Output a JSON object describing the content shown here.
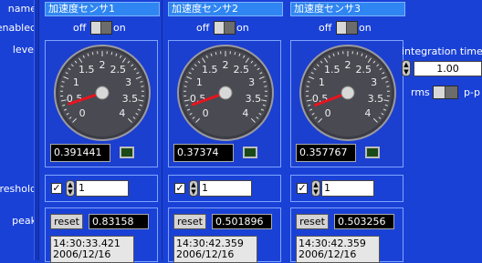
{
  "row_labels": {
    "name": "name",
    "enabled": "enabled",
    "level": "level",
    "threshold": "threshold",
    "peak": "peak"
  },
  "gauge_ticks": [
    "0",
    "0.5",
    "1",
    "1.5",
    "2",
    "2.5",
    "3",
    "3.5",
    "4"
  ],
  "sensors": [
    {
      "name": "加速度センサ1",
      "off_label": "off",
      "on_label": "on",
      "level_value": "0.391441",
      "needle_value": 0.391441,
      "threshold": "1",
      "threshold_checked": true,
      "reset_label": "reset",
      "peak_value": "0.83158",
      "peak_time": "14:30:33.421",
      "peak_date": "2006/12/16"
    },
    {
      "name": "加速度センサ2",
      "off_label": "off",
      "on_label": "on",
      "level_value": "0.37374",
      "needle_value": 0.37374,
      "threshold": "1",
      "threshold_checked": true,
      "reset_label": "reset",
      "peak_value": "0.501896",
      "peak_time": "14:30:42.359",
      "peak_date": "2006/12/16"
    },
    {
      "name": "加速度センサ3",
      "off_label": "off",
      "on_label": "on",
      "level_value": "0.357767",
      "needle_value": 0.357767,
      "threshold": "1",
      "threshold_checked": true,
      "reset_label": "reset",
      "peak_value": "0.503256",
      "peak_time": "14:30:42.359",
      "peak_date": "2006/12/16"
    }
  ],
  "integration": {
    "label": "integration time [s",
    "value": "1.00",
    "rms_label": "rms",
    "pp_label": "p-p"
  },
  "colors": {
    "background": "#1a41d6",
    "name_field": "#2f86f2",
    "needle": "#e8141e",
    "led_off": "#1b4a18"
  }
}
